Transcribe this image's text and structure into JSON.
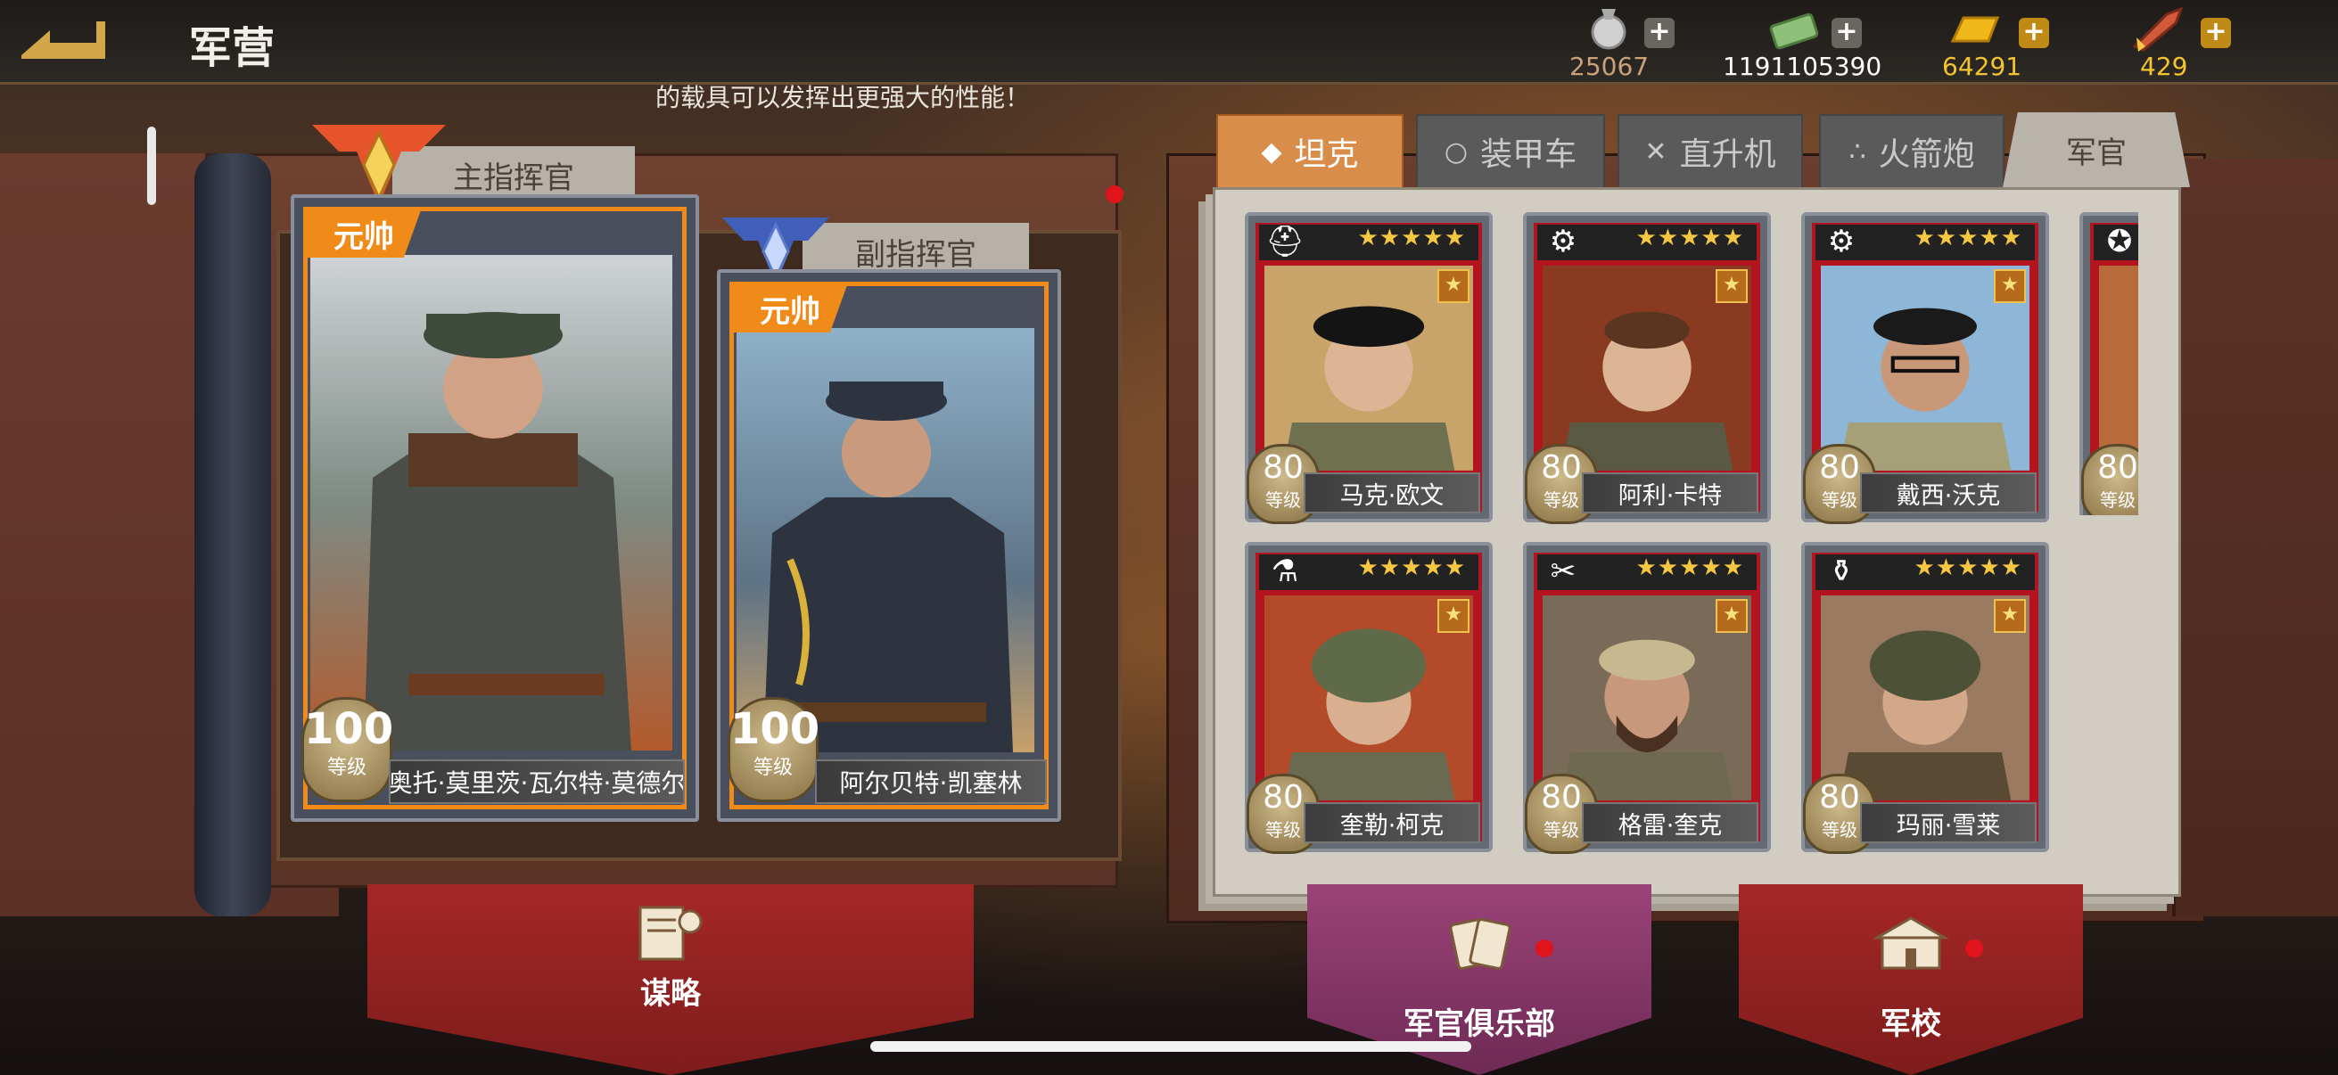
{
  "header": {
    "title": "军营",
    "resources": [
      {
        "icon": "medal-icon",
        "value": "25067",
        "color": "#c9a27a"
      },
      {
        "icon": "cash-icon",
        "value": "1191105390",
        "color": "#ffffff"
      },
      {
        "icon": "gold-bar-icon",
        "value": "64291",
        "color": "#f4c430"
      },
      {
        "icon": "rocket-icon",
        "value": "429",
        "color": "#f4c430"
      }
    ]
  },
  "notice": "的载具可以发挥出更强大的性能！",
  "commanders": {
    "main_label": "主指挥官",
    "sub_label": "副指挥官",
    "main": {
      "rank": "元帅",
      "level": "100",
      "level_label": "等级",
      "name": "奥托·莫里茨·瓦尔特·莫德尔"
    },
    "sub": {
      "rank": "元帅",
      "level": "100",
      "level_label": "等级",
      "name": "阿尔贝特·凯塞林"
    }
  },
  "tabs": [
    {
      "label": "坦克",
      "icon": "diamond-icon",
      "active": true
    },
    {
      "label": "装甲车",
      "icon": "circle-icon",
      "active": false
    },
    {
      "label": "直升机",
      "icon": "cross-icon",
      "active": false
    },
    {
      "label": "火箭炮",
      "icon": "cluster-icon",
      "active": false
    }
  ],
  "officer_tab": "军官",
  "officers": [
    {
      "name": "马克·欧文",
      "level": "80",
      "level_label": "等级",
      "stars": "★★★★★",
      "type_icon": "cap-icon"
    },
    {
      "name": "阿利·卡特",
      "level": "80",
      "level_label": "等级",
      "stars": "★★★★★",
      "type_icon": "gear-icon"
    },
    {
      "name": "戴西·沃克",
      "level": "80",
      "level_label": "等级",
      "stars": "★★★★★",
      "type_icon": "gears-icon"
    },
    {
      "name": "奎勒·柯克",
      "level": "80",
      "level_label": "等级",
      "stars": "★★★★★",
      "type_icon": "flask-icon"
    },
    {
      "name": "格雷·奎克",
      "level": "80",
      "level_label": "等级",
      "stars": "★★★★★",
      "type_icon": "wrench-icon"
    },
    {
      "name": "玛丽·雪莱",
      "level": "80",
      "level_label": "等级",
      "stars": "★★★★★",
      "type_icon": "bottle-icon"
    },
    {
      "name": "",
      "level": "80",
      "level_label": "等级",
      "stars": "",
      "type_icon": "star-badge-icon"
    }
  ],
  "bottom_buttons": [
    {
      "label": "谋略",
      "icon": "strategy-icon",
      "color": "#b22b2b"
    },
    {
      "label": "军官俱乐部",
      "icon": "cards-icon",
      "color": "#8b3a6c"
    },
    {
      "label": "军校",
      "icon": "school-icon",
      "color": "#b22b2b"
    }
  ]
}
